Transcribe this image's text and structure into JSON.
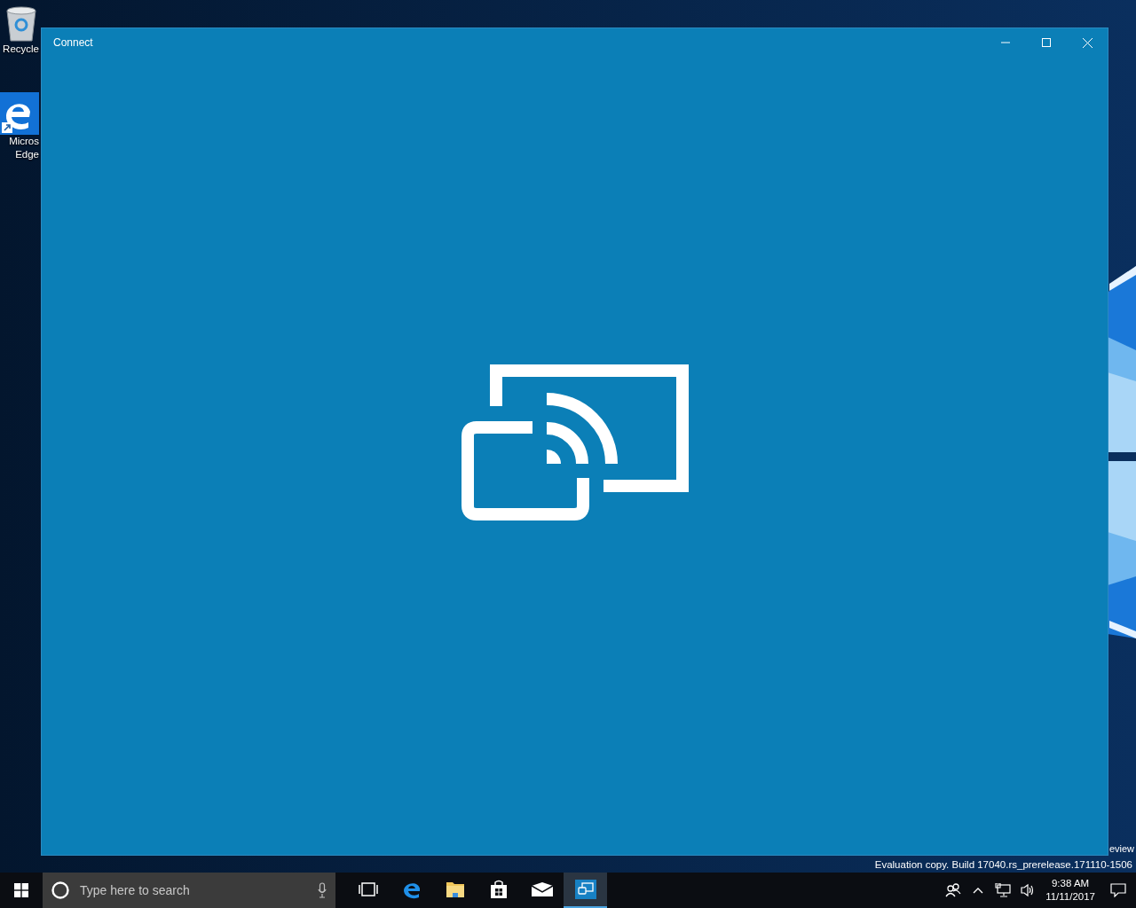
{
  "desktop": {
    "icons": [
      {
        "kind": "recycle-bin",
        "label": "Recycle"
      },
      {
        "kind": "edge-shortcut",
        "label": "Micros\nEdge"
      }
    ]
  },
  "window": {
    "title": "Connect",
    "controls": [
      {
        "kind": "minimize"
      },
      {
        "kind": "maximize"
      },
      {
        "kind": "close"
      }
    ]
  },
  "desktop_text": {
    "edition": "eview",
    "build": "Evaluation copy. Build 17040.rs_prerelease.171110-1506"
  },
  "taskbar": {
    "search": {
      "placeholder": "Type here to search"
    },
    "apps": [
      {
        "kind": "task-view",
        "selected": false
      },
      {
        "kind": "edge",
        "selected": false
      },
      {
        "kind": "explorer",
        "selected": false
      },
      {
        "kind": "store",
        "selected": false
      },
      {
        "kind": "mail",
        "selected": false
      },
      {
        "kind": "connect",
        "selected": true
      }
    ],
    "tray": [
      {
        "kind": "people"
      },
      {
        "kind": "chevron"
      },
      {
        "kind": "network"
      },
      {
        "kind": "volume"
      }
    ],
    "clock": {
      "time": "9:38 AM",
      "date": "11/11/2017"
    }
  }
}
